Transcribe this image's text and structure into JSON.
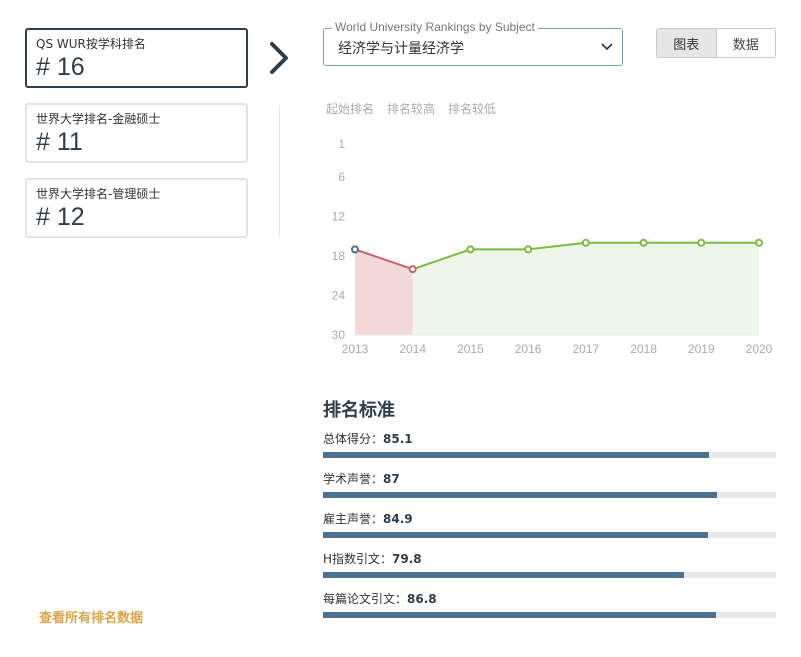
{
  "rank_cards": [
    {
      "label": "QS WUR按学科排名",
      "rank": "# 16",
      "active": true
    },
    {
      "label": "世界大学排名-金融硕士",
      "rank": "# 11",
      "active": false
    },
    {
      "label": "世界大学排名-管理硕士",
      "rank": "# 12",
      "active": false
    }
  ],
  "view_all_label": "查看所有排名数据",
  "subject_select": {
    "legend": "World University Rankings by Subject",
    "value": "经济学与计量经济学"
  },
  "view_toggle": {
    "chart_label": "图表",
    "data_label": "数据",
    "selected": "chart"
  },
  "chart_filters": [
    "起始排名",
    "排名较高",
    "排名较低"
  ],
  "chart_data": {
    "type": "line",
    "x": [
      2013,
      2014,
      2015,
      2016,
      2017,
      2018,
      2019,
      2020
    ],
    "y_ticks": [
      1,
      6,
      12,
      18,
      24,
      30
    ],
    "ylim": [
      1,
      30
    ],
    "y_inverted": true,
    "series": [
      {
        "values": [
          17,
          20,
          17,
          17,
          16,
          16,
          16,
          16
        ]
      }
    ],
    "colors": {
      "start": "#4a7190",
      "lower": "#c9636a",
      "higher": "#7dbb42",
      "lower_fill": "#f2d9d8",
      "higher_fill": "#eef6ea"
    }
  },
  "criteria": {
    "title": "排名标准",
    "items": [
      {
        "label": "总体得分：",
        "value": "85.1",
        "score": 85.1
      },
      {
        "label": "学术声誉：",
        "value": "87",
        "score": 87
      },
      {
        "label": "雇主声誉：",
        "value": "84.9",
        "score": 84.9
      },
      {
        "label": "H指数引文：",
        "value": "79.8",
        "score": 79.8
      },
      {
        "label": "每篇论文引文：",
        "value": "86.8",
        "score": 86.8
      }
    ],
    "bar_color": "#4a7190"
  }
}
